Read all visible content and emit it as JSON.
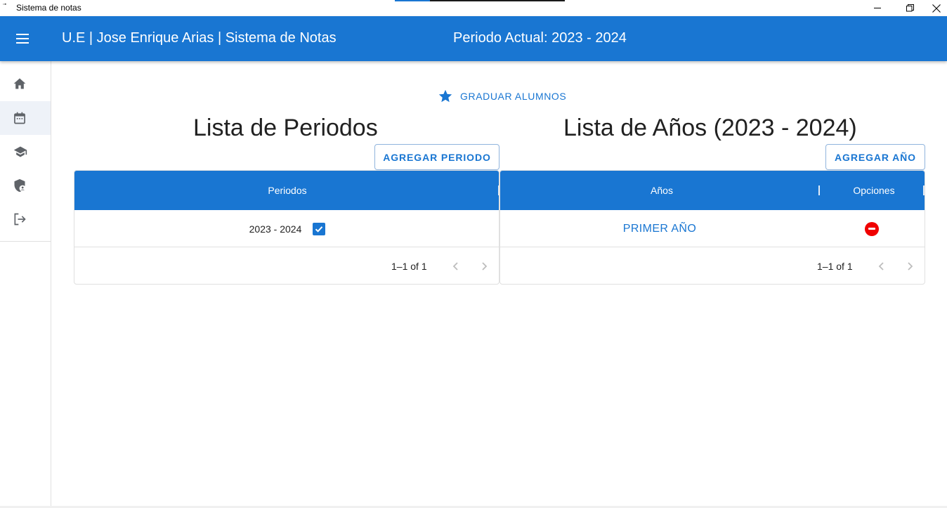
{
  "window": {
    "title": "Sistema de notas",
    "icon": "app-icon"
  },
  "appbar": {
    "menu_icon": "menu-icon",
    "title": "U.E | Jose Enrique Arias | Sistema de Notas",
    "period": "Periodo Actual: 2023 - 2024",
    "color": "#1976d2"
  },
  "sidebar": {
    "items": [
      {
        "icon": "home-icon",
        "active": false
      },
      {
        "icon": "calendar-icon",
        "active": true
      },
      {
        "icon": "graduation-cap-icon",
        "active": false
      },
      {
        "icon": "shield-user-icon",
        "active": false
      },
      {
        "icon": "logout-icon",
        "active": false
      }
    ]
  },
  "main": {
    "graduate_button": "GRADUAR ALUMNOS",
    "periods": {
      "title": "Lista de Periodos",
      "add_button": "AGREGAR PERIODO",
      "columns": [
        "Periodos"
      ],
      "rows": [
        {
          "period": "2023 - 2024",
          "checked": true
        }
      ],
      "pagination": "1–1 of 1"
    },
    "years": {
      "title": "Lista de Años (2023 - 2024)",
      "add_button": "AGREGAR AÑO",
      "columns": [
        "Años",
        "Opciones"
      ],
      "rows": [
        {
          "year": "PRIMER AÑO",
          "option_icon": "remove-circle-icon"
        }
      ],
      "pagination": "1–1 of 1"
    }
  }
}
